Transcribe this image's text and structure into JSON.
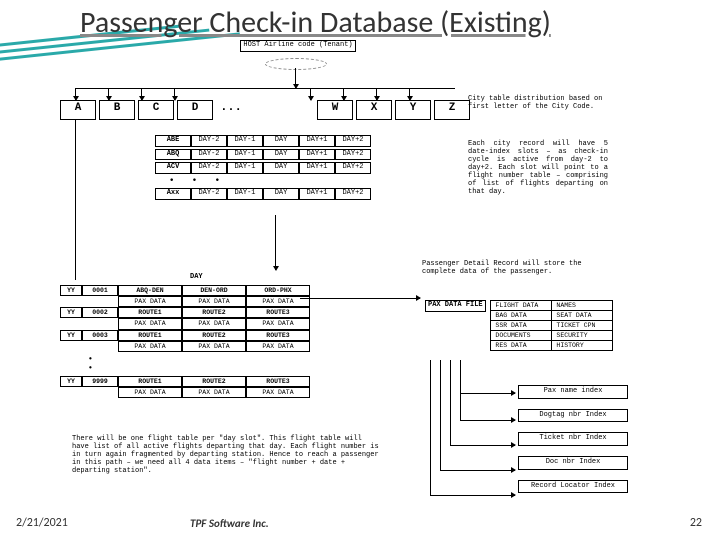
{
  "title": "Passenger Check-in Database (Existing)",
  "footer": {
    "date": "2/21/2021",
    "company": "TPF Software Inc.",
    "page": "22"
  },
  "host_label": "HOST Airline code\n(Tenant)",
  "letters": [
    "A",
    "B",
    "C",
    "D",
    "...",
    "W",
    "X",
    "Y",
    "Z"
  ],
  "annotations": {
    "a1": "City table distribution based on first letter of the City Code.",
    "a2": "Each city record will have 5 date-index slots – as check-in cycle is active from day-2 to day+2. Each slot will point to a flight number table – comprising of list of flights departing on that day.",
    "a3": "Passenger Detail Record will store the complete data of the passenger.",
    "a4": "There will be one flight table per \"day slot\". This flight table will have list of all active flights departing that day. Each flight number is in turn again fragmented by departing station. Hence to reach a passenger in this path – we need all 4 data items – \"flight number + date + departing station\"."
  },
  "day_cols": [
    "DAY-2",
    "DAY-1",
    "DAY",
    "DAY+1",
    "DAY+2"
  ],
  "cities": [
    "ABE",
    "ABQ",
    "ACV",
    "Axx"
  ],
  "flight_hdr": "DAY",
  "flights": [
    {
      "yy": "YY",
      "num": "0001",
      "r": [
        "ABQ-DEN",
        "DEN-ORD",
        "ORD-PHX"
      ],
      "p": "PAX DATA"
    },
    {
      "yy": "YY",
      "num": "0002",
      "r": [
        "ROUTE1",
        "ROUTE2",
        "ROUTE3"
      ],
      "p": "PAX DATA"
    },
    {
      "yy": "YY",
      "num": "0003",
      "r": [
        "ROUTE1",
        "ROUTE2",
        "ROUTE3"
      ],
      "p": "PAX DATA"
    },
    {
      "yy": "YY",
      "num": "9999",
      "r": [
        "ROUTE1",
        "ROUTE2",
        "ROUTE3"
      ],
      "p": "PAX DATA"
    }
  ],
  "pax_file_label": "PAX DATA FILE",
  "pax_file_rows": [
    [
      "FLIGHT DATA",
      "NAMES"
    ],
    [
      "BAG DATA",
      "SEAT DATA"
    ],
    [
      "SSR DATA",
      "TICKET CPN"
    ],
    [
      "DOCUMENTS",
      "SECURITY"
    ],
    [
      "RES DATA",
      "HISTORY"
    ]
  ],
  "indexes": [
    "Pax name index",
    "Dogtag nbr Index",
    "Ticket nbr Index",
    "Doc nbr Index",
    "Record Locator Index"
  ]
}
